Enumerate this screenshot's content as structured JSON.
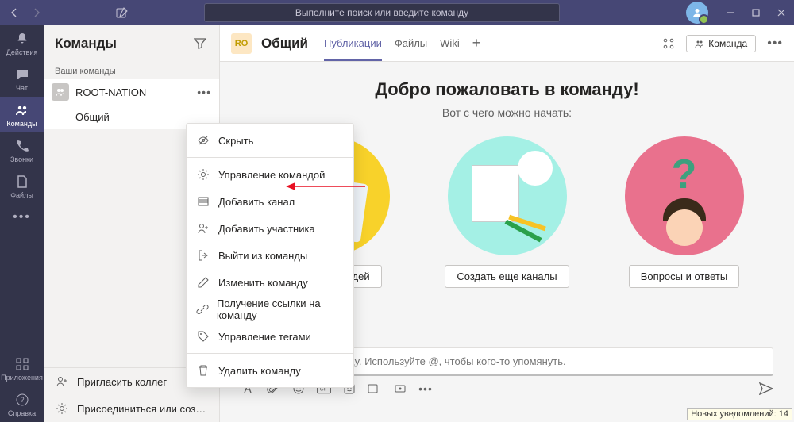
{
  "titlebar": {
    "search_placeholder": "Выполните поиск или введите команду"
  },
  "rail": {
    "items": [
      {
        "label": "Действия"
      },
      {
        "label": "Чат"
      },
      {
        "label": "Команды"
      },
      {
        "label": "Звонки"
      },
      {
        "label": "Файлы"
      }
    ],
    "apps_label": "Приложения",
    "help_label": "Справка"
  },
  "panel": {
    "title": "Команды",
    "your_teams": "Ваши команды",
    "team_name": "ROOT-NATION",
    "team_initials": "RO",
    "channel_general": "Общий",
    "invite": "Пригласить коллег",
    "join_create": "Присоединиться или соз…"
  },
  "main": {
    "channel_initials": "RO",
    "channel_title": "Общий",
    "tabs": {
      "posts": "Публикации",
      "files": "Файлы",
      "wiki": "Wiki"
    },
    "team_button": "Команда",
    "welcome_title": "Добро пожаловать в команду!",
    "welcome_sub": "Вот с чего можно начать:",
    "card1_btn": "Добавить людей",
    "card2_btn": "Создать еще каналы",
    "card3_btn": "Вопросы и ответы",
    "compose_placeholder": "Начните новую беседу. Используйте @, чтобы кого-то упомянуть."
  },
  "ctx": {
    "hide": "Скрыть",
    "manage": "Управление командой",
    "add_channel": "Добавить канал",
    "add_member": "Добавить участника",
    "leave": "Выйти из команды",
    "edit": "Изменить команду",
    "link": "Получение ссылки на команду",
    "tags": "Управление тегами",
    "delete": "Удалить команду"
  },
  "notif": "Новых уведомлений: 14"
}
